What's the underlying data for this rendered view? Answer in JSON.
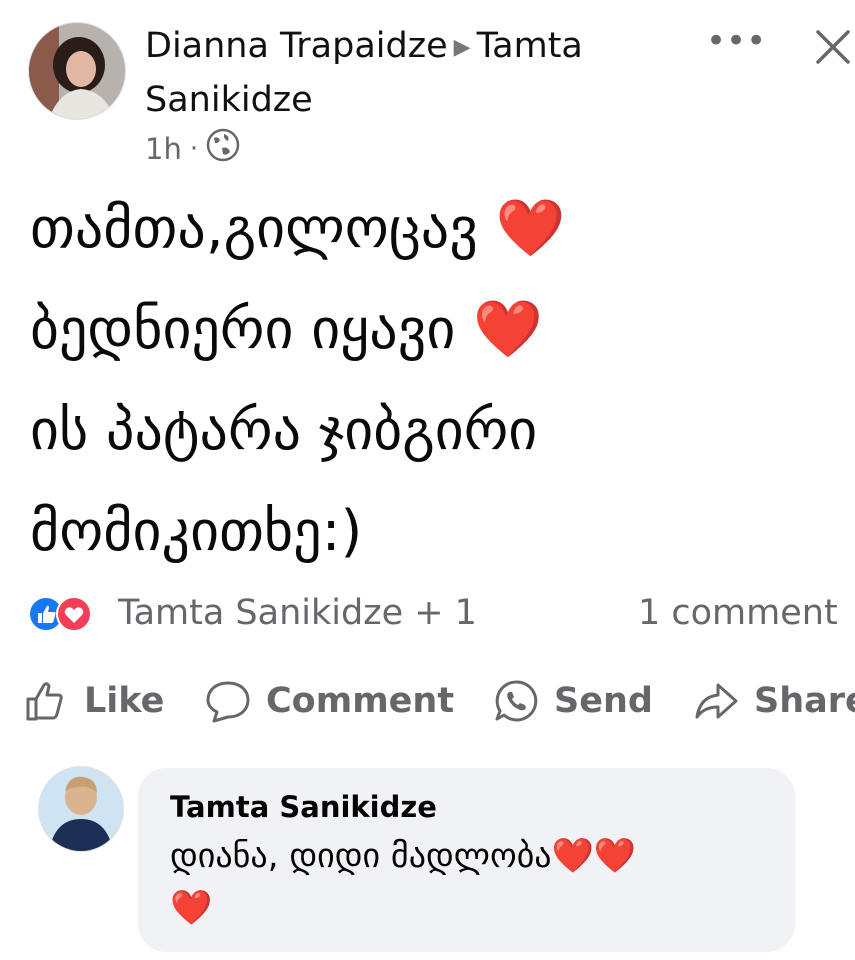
{
  "post": {
    "author": "Dianna Trapaidze",
    "recipient": "Tamta Sanikidze",
    "time": "1h",
    "privacy_icon": "globe-icon",
    "line1": "თამთა,გილოცავ",
    "line2": "ბედნიერი იყავი",
    "line3": "ის პატარა ჯიბგირი",
    "line4": "მომიკითხე:)",
    "heart": "❤️"
  },
  "reactions": {
    "icons": [
      "like-icon",
      "love-icon"
    ],
    "names": "Tamta Sanikidze + 1",
    "comment_count": "1 comment"
  },
  "actions": {
    "like": "Like",
    "comment": "Comment",
    "send": "Send",
    "share": "Share"
  },
  "comment": {
    "author": "Tamta Sanikidze",
    "text": "დიანა, დიდი მადლობა",
    "hearts_inline": "❤️❤️",
    "heart_wrap": "❤️"
  },
  "colors": {
    "secondary_text": "#65676b",
    "like_blue": "#1877f2",
    "love_red": "#f33e58",
    "bubble_bg": "#f0f2f5"
  }
}
